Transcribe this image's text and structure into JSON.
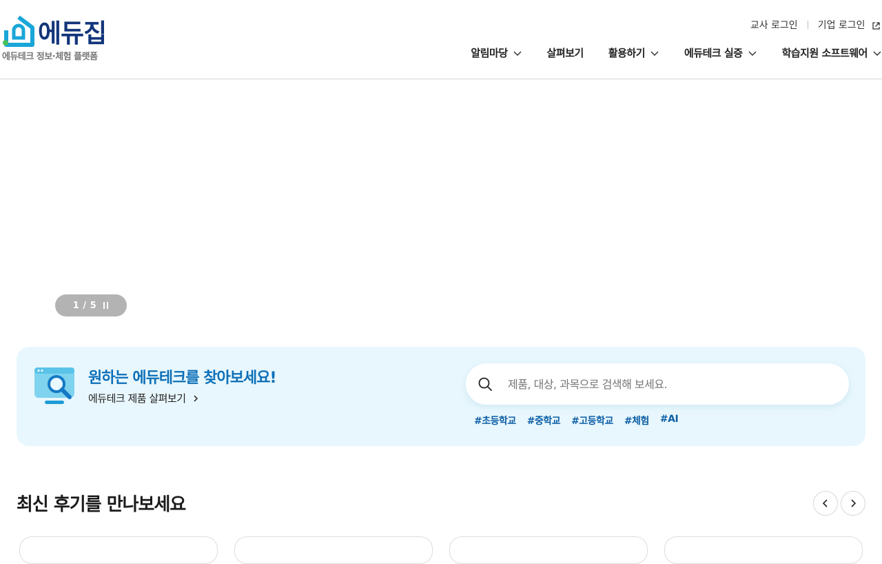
{
  "header": {
    "logo": {
      "name": "에듀집",
      "tagline": "에듀테크 정보·체험 플랫폼"
    },
    "util_nav": {
      "teacher_login": "교사 로그인",
      "company_login": "기업 로그인"
    },
    "gnb": [
      {
        "label": "알림마당",
        "has_dropdown": true
      },
      {
        "label": "살펴보기",
        "has_dropdown": false
      },
      {
        "label": "활용하기",
        "has_dropdown": true
      },
      {
        "label": "에듀테크 실증",
        "has_dropdown": true
      },
      {
        "label": "학습지원 소프트웨어",
        "has_dropdown": true
      }
    ]
  },
  "hero": {
    "slide_indicator": "1 / 5"
  },
  "search_band": {
    "title": "원하는 에듀테크를 찾아보세요!",
    "link_label": "에듀테크 제품 살펴보기",
    "search_placeholder": "제품, 대상, 과목으로 검색해 보세요.",
    "tags": [
      "#초등학교",
      "#중학교",
      "#고등학교",
      "#체험",
      "#AI"
    ]
  },
  "reviews": {
    "title": "최신 후기를 만나보세요"
  },
  "colors": {
    "brand_navy": "#13357a",
    "brand_blue": "#0c6fb8",
    "tag_blue": "#0d5fa6",
    "band_bg": "#e8f7fd",
    "logo_teal": "#1aa6d8",
    "logo_green": "#4cc15a"
  },
  "icons": {
    "logo_mark": "edu-zip-logo-icon",
    "external": "external-link-icon",
    "dropdown": "chevron-down-icon",
    "pause": "pause-icon",
    "search_illus": "search-monitor-icon",
    "arrow": "chevron-right-icon",
    "search": "search-icon",
    "prev": "chevron-left-icon",
    "next": "chevron-right-icon"
  }
}
